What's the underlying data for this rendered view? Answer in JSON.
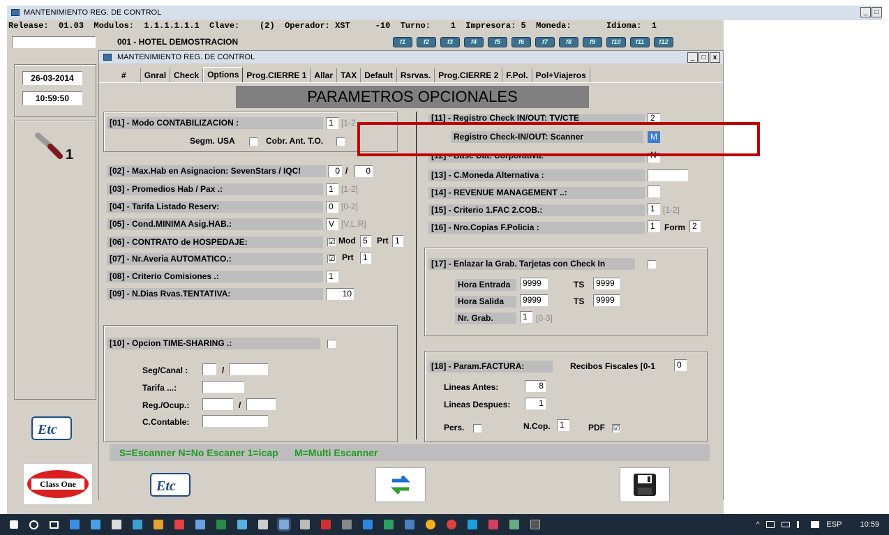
{
  "window": {
    "title": "MANTENIMIENTO REG. DE CONTROL"
  },
  "release_line": "Release:  01.03  Modulos:  1.1.1.1.1.1  Clave:    (2)  Operador: XST     -10  Turno:    1  Impresora: 5  Moneda:       Idioma:  1",
  "hotel": "001 - HOTEL DEMOSTRACION",
  "fkeys": [
    "f1",
    "f2",
    "f3",
    "f4",
    "f5",
    "f6",
    "f7",
    "f8",
    "f9",
    "f10",
    "f11",
    "f12"
  ],
  "date": "26-03-2014",
  "time": "10:59:50",
  "inner_title": "MANTENIMIENTO REG. DE CONTROL",
  "tabs": [
    "#",
    "Gnral",
    "Check",
    "Options",
    "Prog.CIERRE 1",
    "Allar",
    "TAX",
    "Default",
    "Rsrvas.",
    "Prog.CIERRE 2",
    "F.Pol.",
    "Pol+Viajeros"
  ],
  "banner": "PARAMETROS OPCIONALES",
  "left": {
    "p01": {
      "label": "[01] - Modo CONTABILIZACION :",
      "value": "1",
      "hint": "[1-2"
    },
    "segm_usa": "Segm. USA",
    "cobr": "Cobr. Ant. T.O.",
    "p02": {
      "label": "[02] - Max.Hab en Asignacion: SevenStars / IQC!",
      "v1": "0",
      "sep": "/",
      "v2": "0"
    },
    "p03": {
      "label": "[03] - Promedios Hab / Pax .:",
      "value": "1",
      "hint": "[1-2]"
    },
    "p04": {
      "label": "[04] - Tarifa Listado Reserv:",
      "value": "0",
      "hint": "[0-2]"
    },
    "p05": {
      "label": "[05] - Cond.MINIMA Asig.HAB.:",
      "value": "V",
      "hint": "[V,L,R]"
    },
    "p06": {
      "label": "[06] - CONTRATO de HOSPEDAJE:",
      "check": "☑",
      "mod": "Mod",
      "mod_v": "5",
      "prt": "Prt",
      "prt_v": "1"
    },
    "p07": {
      "label": "[07] - Nr.Averia AUTOMATICO.:",
      "check": "☑",
      "prt": "Prt",
      "prt_v": "1"
    },
    "p08": {
      "label": "[08] - Criterio Comisiones .:",
      "value": "1"
    },
    "p09": {
      "label": "[09] - N.Dias Rvas.TENTATIVA:",
      "value": "10"
    },
    "p10": {
      "label": "[10] - Opcion TIME-SHARING .:"
    },
    "seg": "Seg/Canal :",
    "slash": "/",
    "tarifa": "Tarifa ...:",
    "reg": "Reg./Ocup.:",
    "ccont": "C.Contable:"
  },
  "right": {
    "p11": {
      "label": "[11] - Registro Check IN/OUT: TV/CTE",
      "value": "2"
    },
    "scanner": {
      "label": "Registro Check-IN/OUT: Scanner",
      "value": "M"
    },
    "p12": {
      "label": "[12] - Base Dat. Corporativa:",
      "value": "N"
    },
    "p13": {
      "label": "[13] - C.Moneda Alternativa :"
    },
    "p14": {
      "label": "[14] - REVENUE MANAGEMENT ..:"
    },
    "p15": {
      "label": "[15] - Criterio 1.FAC 2.COB.:",
      "value": "1",
      "hint": "[1-2]"
    },
    "p16": {
      "label": "[16] - Nro.Copias F.Policia :",
      "value": "1",
      "form": "Form",
      "form_v": "2"
    },
    "p17": {
      "label": "[17] - Enlazar la Grab. Tarjetas con Check In"
    },
    "hora_entrada": "Hora Entrada",
    "he_v": "9999",
    "ts": "TS",
    "ts1_v": "9999",
    "hora_salida": "Hora Salida",
    "hs_v": "9999",
    "ts2_v": "9999",
    "nr_grab": "Nr. Grab.",
    "nr_v": "1",
    "nr_hint": "[0-3]",
    "p18": {
      "label": "[18] - Param.FACTURA:"
    },
    "recibos": "Recibos Fiscales [0-1",
    "recibos_v": "0",
    "lineas_antes": "Lineas Antes:",
    "la_v": "8",
    "lineas_despues": "Lineas Despues:",
    "ld_v": "1",
    "pers": "Pers.",
    "ncop": "N.Cop.",
    "ncop_v": "1",
    "pdf": "PDF",
    "pdf_check": "☑"
  },
  "legend": "S=Escanner N=No Escaner 1=icap      M=Multi Escanner",
  "class_one": "Class One",
  "tray": {
    "lang": "ESP",
    "clock": "10:59"
  },
  "colors": {
    "legend_green": "#1f9c1f",
    "highlight_red": "#c00000",
    "banner_gray": "#808080"
  }
}
